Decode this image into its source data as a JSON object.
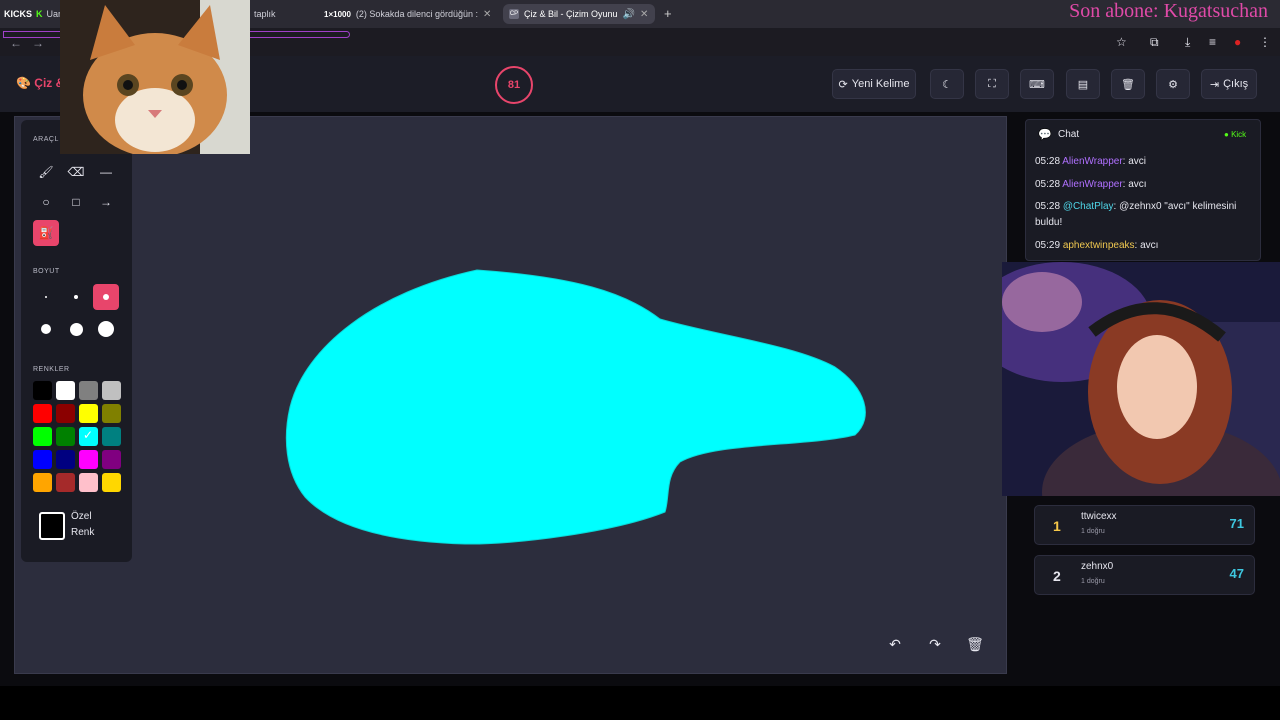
{
  "browser": {
    "brand_tab": {
      "kicks": "KICKS",
      "k": "K",
      "rest": "Uar"
    },
    "tabs": [
      {
        "label": "taplık",
        "fav": ""
      },
      {
        "label": "(2) Sokakda dilenci gördüğün :",
        "fav": "1×1000"
      },
      {
        "label": "Çiz & Bil - Çizim Oyunu",
        "fav": "CP"
      }
    ],
    "overlay": "Son abone: Kugatsuchan"
  },
  "header": {
    "title": "Çiz &",
    "timer": "81",
    "new_word": "Yeni Kelime",
    "exit": "Çıkış"
  },
  "tools": {
    "tools_label": "ARAÇL",
    "size_label": "BOYUT",
    "colors_label": "RENKLER",
    "custom_label_1": "Özel",
    "custom_label_2": "Renk",
    "palette": [
      [
        "#000000",
        "#ffffff",
        "#808080",
        "#c0c0c0"
      ],
      [
        "#ff0000",
        "#8b0000",
        "#ffff00",
        "#808000"
      ],
      [
        "#00ff00",
        "#008000",
        "#00ffff",
        "#008080"
      ],
      [
        "#0000ff",
        "#000080",
        "#ff00ff",
        "#800080"
      ],
      [
        "#ffa500",
        "#a52a2a",
        "#ffc0cb",
        "#ffd700"
      ]
    ],
    "selected_color": "#00ffff"
  },
  "chat": {
    "title": "Chat",
    "badge": "Kick",
    "messages": [
      {
        "time": "05:28",
        "user": "AlienWrapper",
        "text": ": avci",
        "color": "#b070ff"
      },
      {
        "time": "05:28",
        "user": "AlienWrapper",
        "text": ": avcı",
        "color": "#b070ff"
      },
      {
        "time": "05:28",
        "user": "@ChatPlay",
        "text": ": @zehnx0 \"avcı\" kelimesini buldu!",
        "color": "#4fd6e8"
      },
      {
        "time": "05:29",
        "user": "aphextwinpeaks",
        "text": ": avcı",
        "color": "#f0c850"
      }
    ]
  },
  "leaderboard": [
    {
      "rank": "1",
      "name": "ttwicexx",
      "sub": "1 doğru",
      "score": "71"
    },
    {
      "rank": "2",
      "name": "zehnx0",
      "sub": "1 doğru",
      "score": "47"
    }
  ]
}
